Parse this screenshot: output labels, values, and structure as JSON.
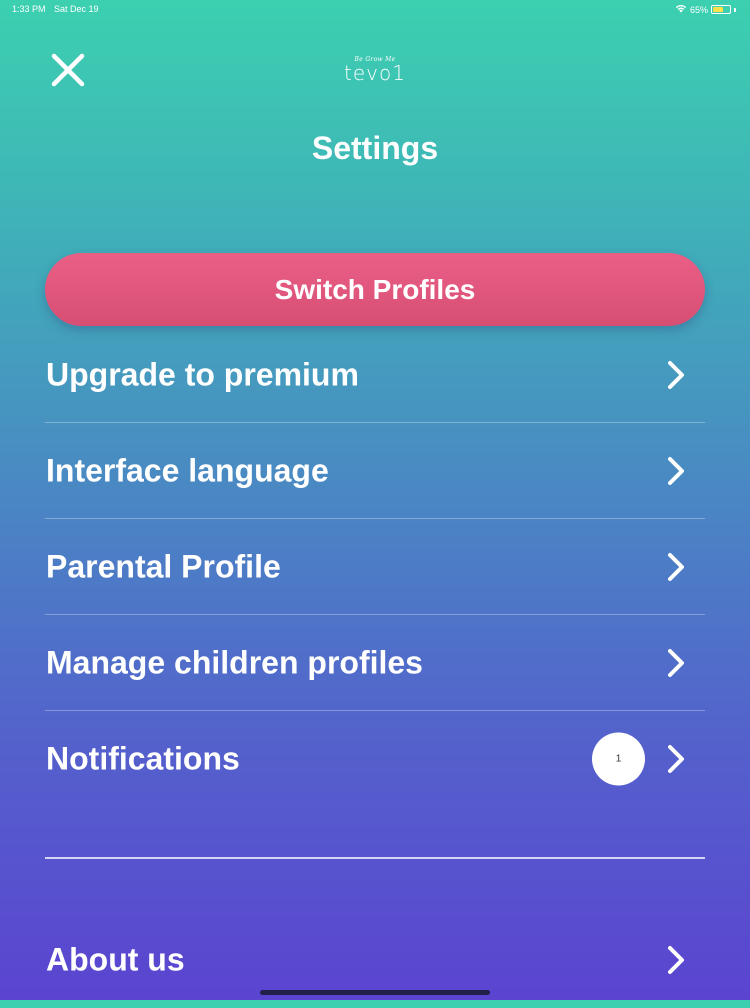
{
  "status_bar": {
    "time": "1:33 PM",
    "date": "Sat Dec 19",
    "battery": "65%",
    "battery_level": 0.65,
    "icons": [
      "wifi-icon",
      "battery-icon"
    ]
  },
  "header": {
    "close_icon": "close-icon",
    "logo_tagline": "Be Grow Me",
    "logo_word": "tevo1",
    "title": "Settings"
  },
  "switch_profiles": {
    "label": "Switch Profiles",
    "color": "#e55a80"
  },
  "menu": {
    "items": [
      {
        "label": "Upgrade to premium",
        "icon": "chevron-right-icon"
      },
      {
        "label": "Interface language",
        "icon": "chevron-right-icon"
      },
      {
        "label": "Parental Profile",
        "icon": "chevron-right-icon"
      },
      {
        "label": "Manage children profiles",
        "icon": "chevron-right-icon"
      },
      {
        "label": "Notifications",
        "badge": "1",
        "icon": "chevron-right-icon"
      }
    ]
  },
  "secondary_menu": {
    "items": [
      {
        "label": "About us",
        "icon": "chevron-right-icon"
      }
    ]
  },
  "colors": {
    "gradient_top": "#3cd0b0",
    "gradient_bottom": "#5a44d0",
    "switch_button": "#e55a80",
    "text": "#ffffff"
  }
}
